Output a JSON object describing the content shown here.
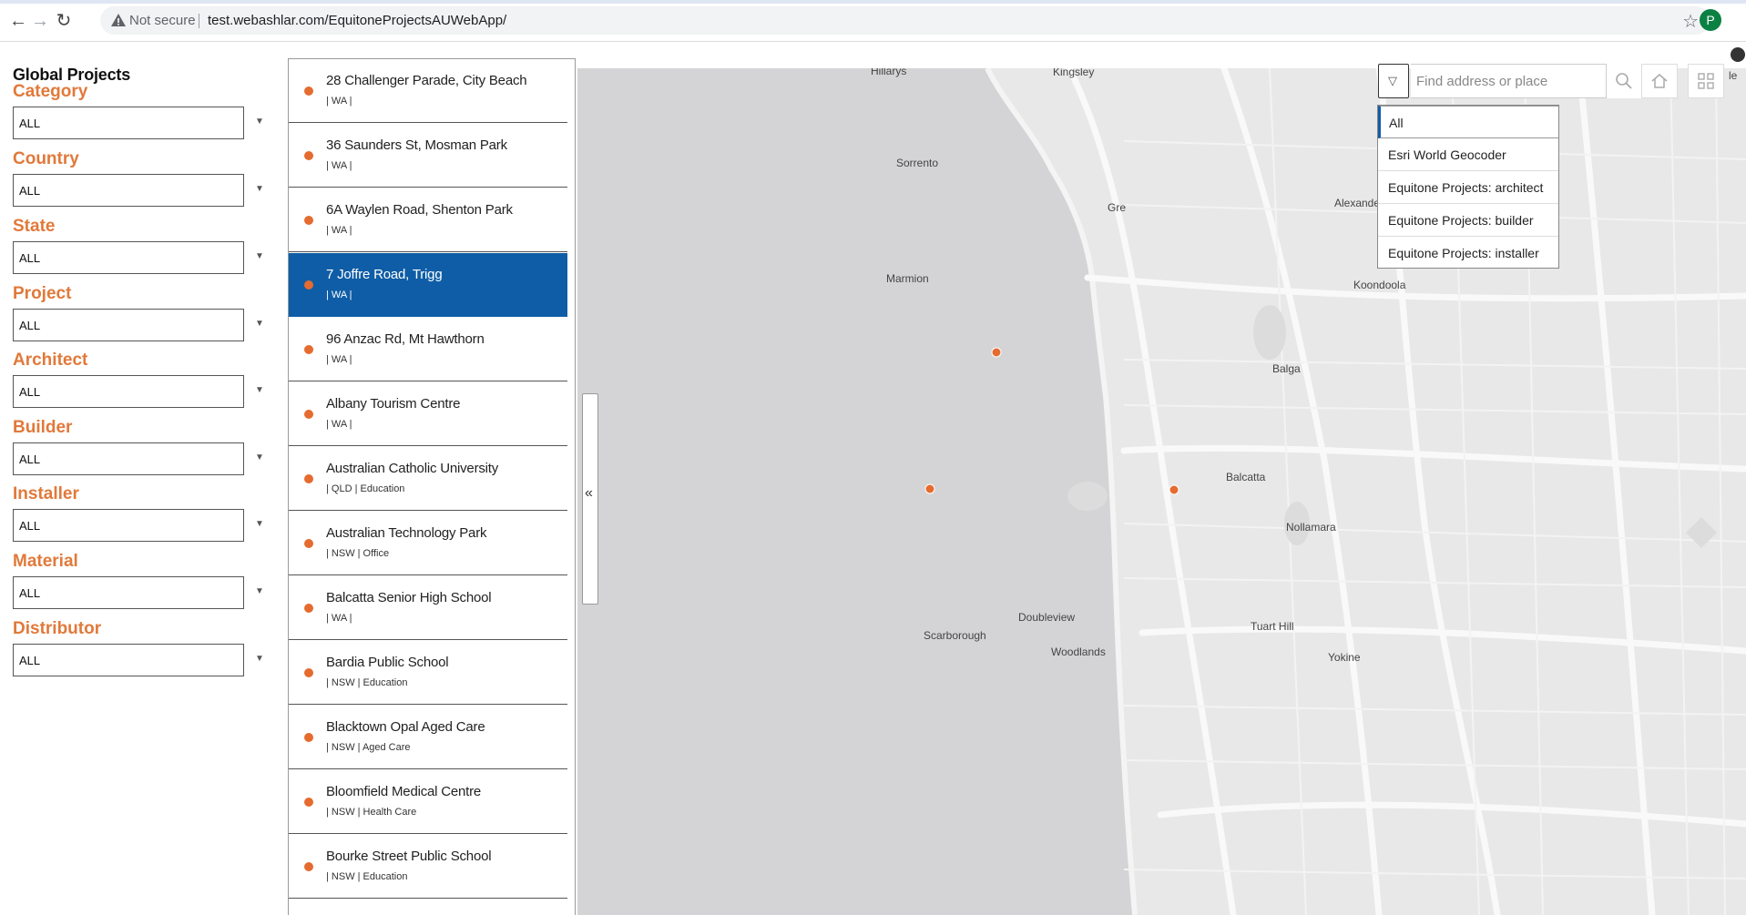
{
  "browser": {
    "not_secure_label": "Not secure",
    "url": "test.webashlar.com/EquitoneProjectsAUWebApp/",
    "profile_initial": "P"
  },
  "filters": {
    "title": "Global Projects",
    "groups": [
      {
        "label": "Category",
        "value": "ALL"
      },
      {
        "label": "Country",
        "value": "ALL"
      },
      {
        "label": "State",
        "value": "ALL"
      },
      {
        "label": "Project",
        "value": "ALL"
      },
      {
        "label": "Architect",
        "value": "ALL"
      },
      {
        "label": "Builder",
        "value": "ALL"
      },
      {
        "label": "Installer",
        "value": "ALL"
      },
      {
        "label": "Material",
        "value": "ALL"
      },
      {
        "label": "Distributor",
        "value": "ALL"
      }
    ]
  },
  "projects": [
    {
      "title": "28 Challenger Parade, City Beach",
      "sub": "| WA |"
    },
    {
      "title": "36 Saunders St, Mosman Park",
      "sub": "| WA |"
    },
    {
      "title": "6A Waylen Road, Shenton Park",
      "sub": "| WA |"
    },
    {
      "title": "7 Joffre Road, Trigg",
      "sub": "| WA |",
      "selected": true
    },
    {
      "title": "96 Anzac Rd, Mt Hawthorn",
      "sub": "| WA |"
    },
    {
      "title": "Albany Tourism Centre",
      "sub": "| WA |"
    },
    {
      "title": "Australian Catholic University",
      "sub": "| QLD | Education"
    },
    {
      "title": "Australian Technology Park",
      "sub": "| NSW | Office"
    },
    {
      "title": "Balcatta Senior High School",
      "sub": "| WA |"
    },
    {
      "title": "Bardia Public School",
      "sub": "| NSW | Education"
    },
    {
      "title": "Blacktown Opal Aged Care",
      "sub": "| NSW | Aged Care"
    },
    {
      "title": "Bloomfield Medical Centre",
      "sub": "| NSW | Health Care"
    },
    {
      "title": "Bourke Street Public School",
      "sub": "| NSW | Education"
    }
  ],
  "collapse_glyph": "«",
  "search": {
    "placeholder": "Find address or place",
    "sources": [
      "All",
      "Esri World Geocoder",
      "Equitone Projects: architect",
      "Equitone Projects: builder",
      "Equitone Projects: installer"
    ]
  },
  "map": {
    "edge_text": "le",
    "labels": [
      "Hillarys",
      "Kingsley",
      "Sorrento",
      "Gre",
      "Alexander Heights",
      "Marmion",
      "Koondoola",
      "Balga",
      "Balcatta",
      "Nollamara",
      "Doubleview",
      "Scarborough",
      "Woodlands",
      "Tuart Hill",
      "Yokine"
    ],
    "marker_color": "#e56b2f"
  },
  "colors": {
    "accent_orange": "#e1793a",
    "selected_blue": "#0f5da6"
  }
}
